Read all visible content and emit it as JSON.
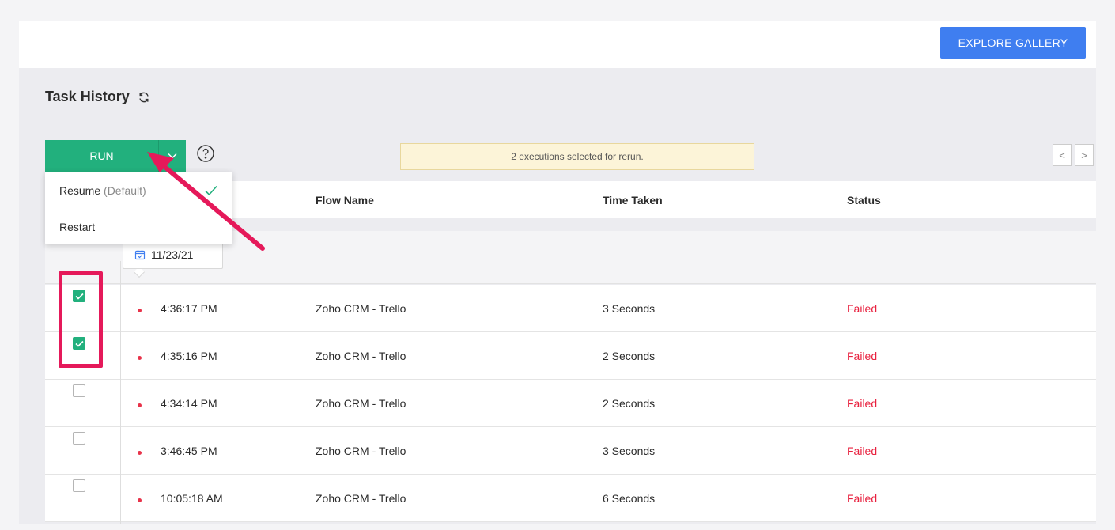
{
  "header": {
    "explore_label": "EXPLORE GALLERY"
  },
  "page": {
    "title": "Task History"
  },
  "toolbar": {
    "run_label": "RUN",
    "notice": "2 executions selected for rerun.",
    "pager_prev": "<",
    "pager_next": ">"
  },
  "dropdown": {
    "items": [
      {
        "label": "Resume",
        "suffix": "(Default)",
        "selected": true
      },
      {
        "label": "Restart",
        "suffix": "",
        "selected": false
      }
    ]
  },
  "table": {
    "columns": [
      "Flow Name",
      "Time Taken",
      "Status"
    ],
    "date": "11/23/21",
    "rows": [
      {
        "checked": true,
        "time": "4:36:17 PM",
        "flow": "Zoho CRM - Trello",
        "duration": "3 Seconds",
        "status": "Failed"
      },
      {
        "checked": true,
        "time": "4:35:16 PM",
        "flow": "Zoho CRM - Trello",
        "duration": "2 Seconds",
        "status": "Failed"
      },
      {
        "checked": false,
        "time": "4:34:14 PM",
        "flow": "Zoho CRM - Trello",
        "duration": "2 Seconds",
        "status": "Failed"
      },
      {
        "checked": false,
        "time": "3:46:45 PM",
        "flow": "Zoho CRM - Trello",
        "duration": "3 Seconds",
        "status": "Failed"
      },
      {
        "checked": false,
        "time": "10:05:18 AM",
        "flow": "Zoho CRM - Trello",
        "duration": "6 Seconds",
        "status": "Failed"
      }
    ]
  },
  "colors": {
    "accent": "#22b07d",
    "primary": "#3f7ef0",
    "failed": "#e8203e",
    "annotation": "#e5195a"
  },
  "icons": [
    "refresh-icon",
    "chevron-down-icon",
    "help-icon",
    "calendar-icon",
    "check-icon",
    "chevron-left-icon",
    "chevron-right-icon"
  ]
}
